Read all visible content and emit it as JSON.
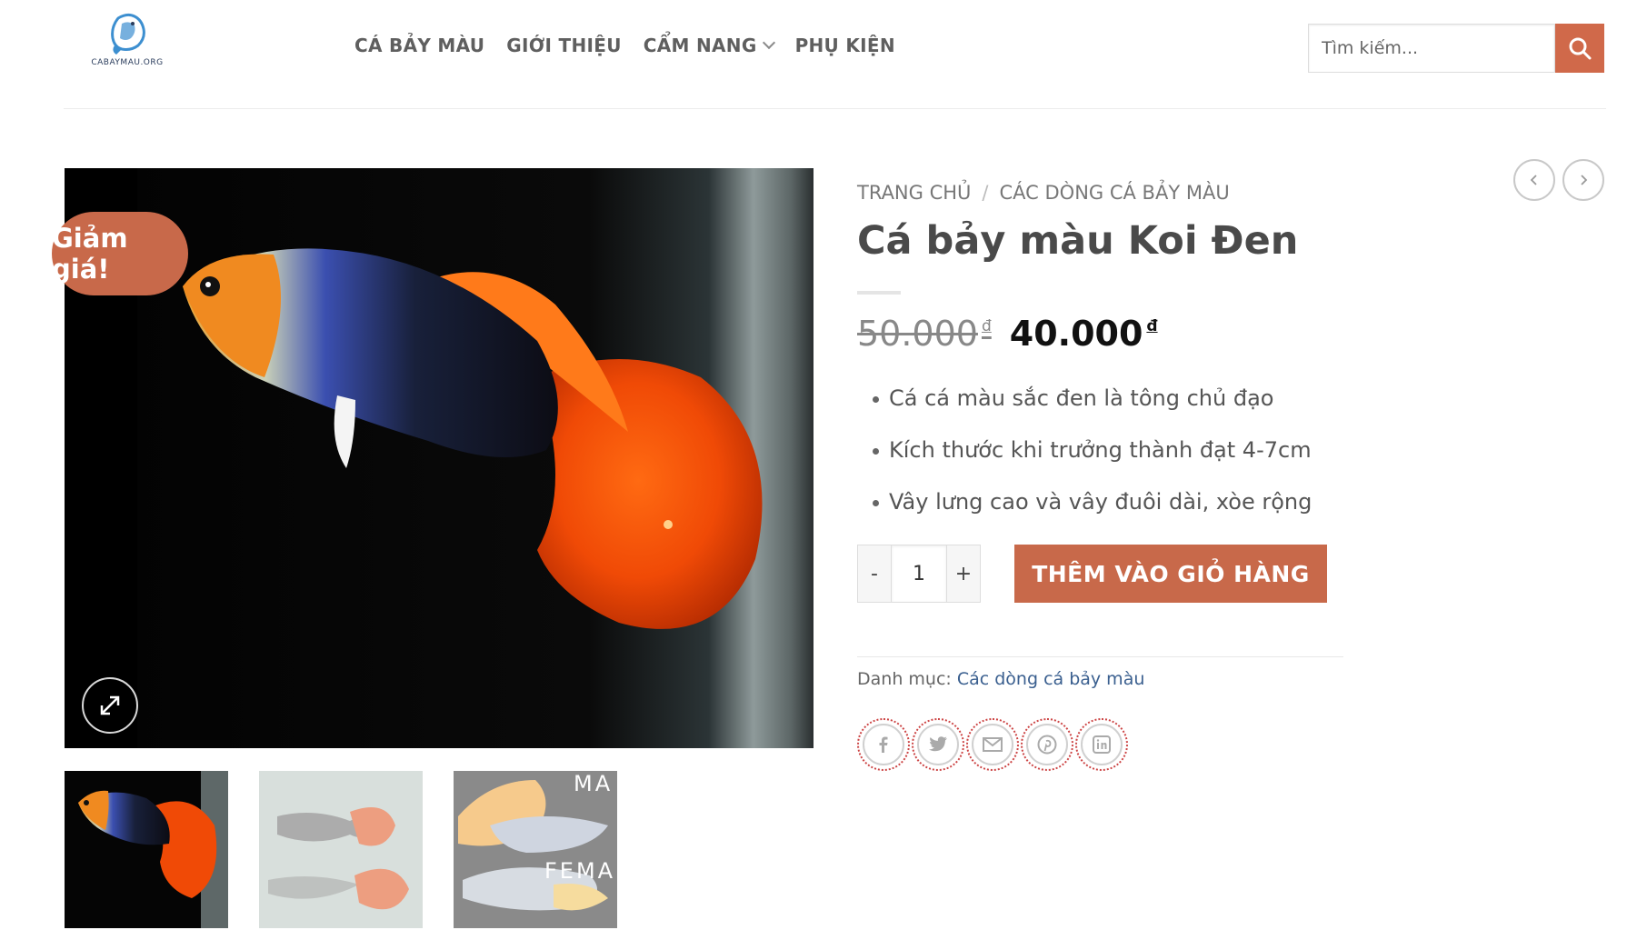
{
  "header": {
    "logo_text": "CABAYMAU.ORG",
    "nav": [
      {
        "label": "CÁ BẢY MÀU"
      },
      {
        "label": "GIỚI THIỆU"
      },
      {
        "label": "CẨM NANG"
      },
      {
        "label": "PHỤ KIỆN"
      }
    ],
    "search_placeholder": "Tìm kiếm..."
  },
  "gallery": {
    "badge": "Giảm giá!",
    "thumb_texts": {
      "male": "MA",
      "female": "FEMA"
    }
  },
  "product": {
    "breadcrumb": [
      "TRANG CHỦ",
      "/",
      "CÁC DÒNG CÁ BẢY MÀU"
    ],
    "title": "Cá bảy màu Koi Đen",
    "old_price": "50.000",
    "new_price": "40.000",
    "currency": "đ",
    "features": [
      "Cá cá màu sắc đen là tông chủ đạo",
      "Kích thước khi trưởng thành đạt 4-7cm",
      "Vây lưng cao và vây đuôi dài, xòe rộng"
    ],
    "qty_minus": "-",
    "qty_value": "1",
    "qty_plus": "+",
    "add_to_cart": "THÊM VÀO GIỎ HÀNG",
    "category_label": "Danh mục:",
    "category_link": "Các dòng cá bảy màu"
  },
  "colors": {
    "accent": "#c8694a",
    "link": "#3a5f8f"
  },
  "icons": [
    "search-icon",
    "chevron-down-icon",
    "expand-icon",
    "chevron-left-icon",
    "chevron-right-icon",
    "facebook-icon",
    "twitter-icon",
    "email-icon",
    "pinterest-icon",
    "linkedin-icon"
  ]
}
